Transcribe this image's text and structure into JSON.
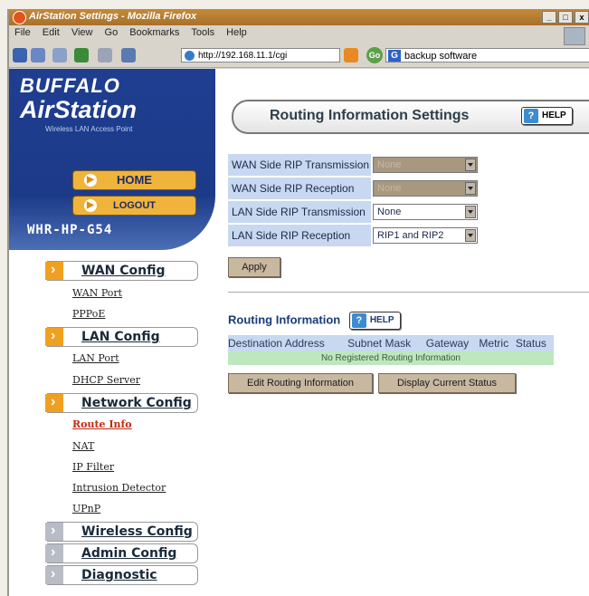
{
  "window": {
    "title": "AirStation Settings - Mozilla Firefox",
    "controls": [
      "_",
      "□",
      "x"
    ]
  },
  "menubar": [
    "File",
    "Edit",
    "View",
    "Go",
    "Bookmarks",
    "Tools",
    "Help"
  ],
  "navbar": {
    "url": "http://192.168.11.1/cgi",
    "search": "backup software",
    "search_engine_icon": "G"
  },
  "sidebar": {
    "brand_top": "BUFFALO",
    "brand_main": "AirStation",
    "brand_sub": "Wireless LAN Access Point",
    "home_label": "HOME",
    "logout_label": "LOGOUT",
    "model": "WHR-HP-G54",
    "sections": {
      "wan": {
        "label": "WAN Config",
        "items": [
          "WAN Port",
          "PPPoE"
        ]
      },
      "lan": {
        "label": "LAN Config",
        "items": [
          "LAN Port",
          "DHCP Server"
        ]
      },
      "network": {
        "label": "Network Config",
        "items": [
          "Route Info",
          "NAT",
          "IP Filter",
          "Intrusion Detector",
          "UPnP"
        ]
      },
      "wireless": {
        "label": "Wireless Config"
      },
      "admin": {
        "label": "Admin Config"
      },
      "diagnostic": {
        "label": "Diagnostic"
      }
    }
  },
  "main": {
    "title": "Routing Information Settings",
    "help_label": "HELP",
    "rip_rows": [
      {
        "label": "WAN Side RIP Transmission",
        "value": "None",
        "disabled": true
      },
      {
        "label": "WAN Side RIP Reception",
        "value": "None",
        "disabled": true
      },
      {
        "label": "LAN Side RIP Transmission",
        "value": "None",
        "disabled": false
      },
      {
        "label": "LAN Side RIP Reception",
        "value": "RIP1 and RIP2",
        "disabled": false
      }
    ],
    "apply_label": "Apply",
    "routing_info_label": "Routing Information",
    "table_headers": [
      "Destination Address",
      "Subnet Mask",
      "Gateway",
      "Metric",
      "Status"
    ],
    "no_entries": "No Registered Routing Information",
    "edit_button": "Edit Routing Information",
    "status_button": "Display Current Status"
  },
  "colors": {
    "sidebar_blue": "#1f3e90",
    "accent_orange": "#f0b43c",
    "label_bg": "#c8d8f0",
    "empty_row_bg": "#bde8bd"
  }
}
